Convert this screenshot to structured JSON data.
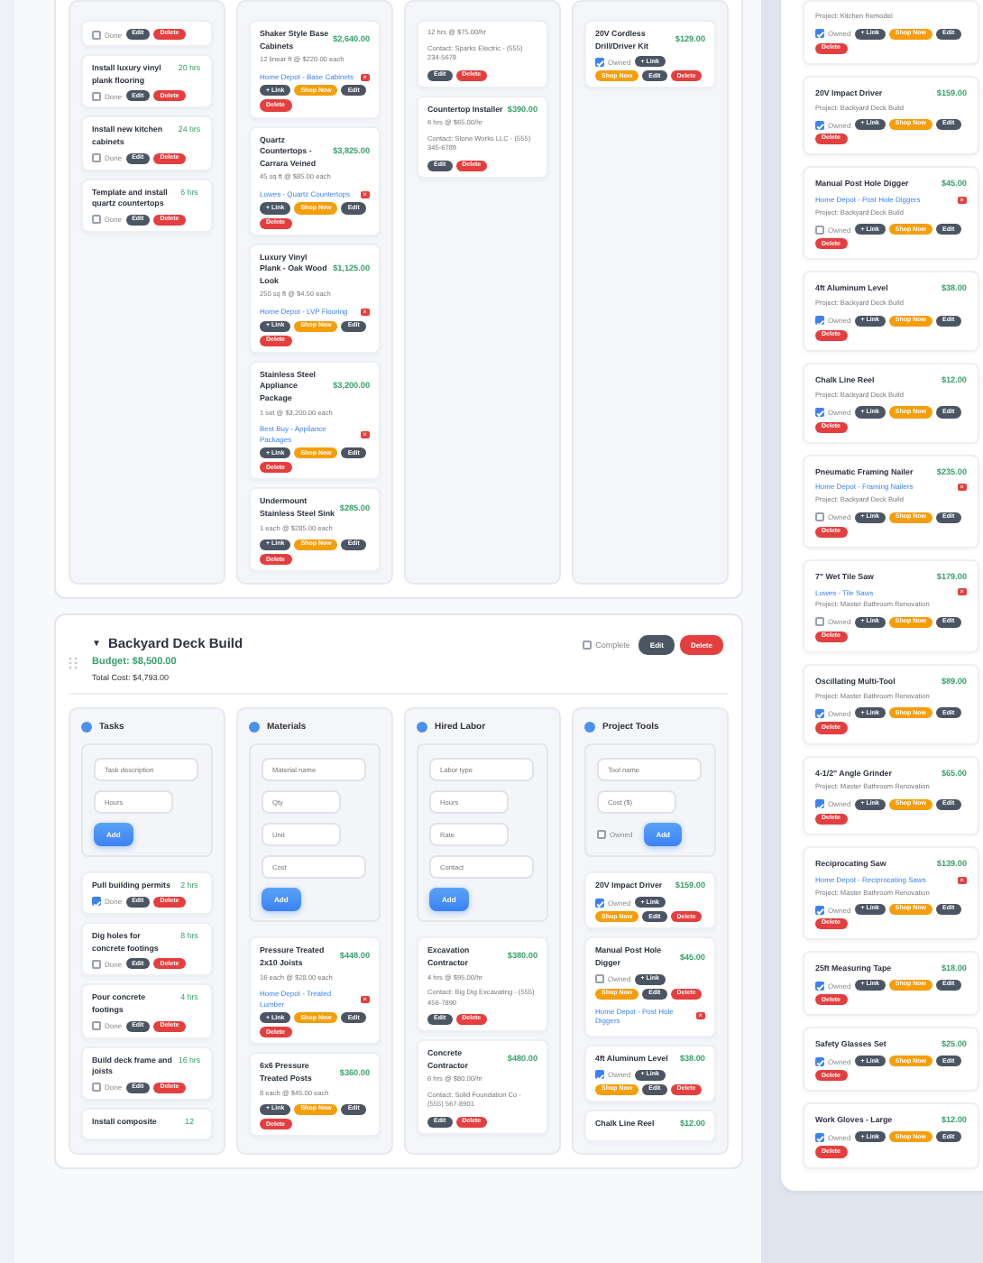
{
  "kitchen_project": {
    "tasks": [
      {
        "done_label": "Done",
        "done": false,
        "edit_button": "Edit",
        "delete_button": "Delete"
      },
      {
        "name": "Install luxury vinyl plank flooring",
        "hours": "20 hrs",
        "done_label": "Done",
        "done": false,
        "edit_button": "Edit",
        "delete_button": "Delete"
      },
      {
        "name": "Install new kitchen cabinets",
        "hours": "24 hrs",
        "done_label": "Done",
        "done": false,
        "edit_button": "Edit",
        "delete_button": "Delete"
      },
      {
        "name": "Template and install quartz countertops",
        "hours": "6 hrs",
        "done_label": "Done",
        "done": false,
        "edit_button": "Edit",
        "delete_button": "Delete"
      }
    ],
    "materials": [
      {
        "name": "Shaker Style Base Cabinets",
        "price": "$2,640.00",
        "detail": "12 linear ft @ $220.00 each",
        "link": "Home Depot - Base Cabinets",
        "link_remove": "×",
        "link_button": "+ Link",
        "shop_button": "Shop Now",
        "edit_button": "Edit",
        "delete_button": "Delete"
      },
      {
        "name": "Quartz Countertops - Carrara Veined",
        "price": "$3,825.00",
        "detail": "45 sq ft @ $85.00 each",
        "link": "Lowes - Quartz Countertops",
        "link_remove": "×",
        "link_button": "+ Link",
        "shop_button": "Shop Now",
        "edit_button": "Edit",
        "delete_button": "Delete"
      },
      {
        "name": "Luxury Vinyl Plank - Oak Wood Look",
        "price": "$1,125.00",
        "detail": "250 sq ft @ $4.50 each",
        "link": "Home Depot - LVP Flooring",
        "link_remove": "×",
        "link_button": "+ Link",
        "shop_button": "Shop Now",
        "edit_button": "Edit",
        "delete_button": "Delete"
      },
      {
        "name": "Stainless Steel Appliance Package",
        "price": "$3,200.00",
        "detail": "1 set @ $3,200.00 each",
        "link": "Best Buy - Appliance Packages",
        "link_remove": "×",
        "link_button": "+ Link",
        "shop_button": "Shop Now",
        "edit_button": "Edit",
        "delete_button": "Delete"
      },
      {
        "name": "Undermount Stainless Steel Sink",
        "price": "$285.00",
        "detail": "1 each @ $285.00 each",
        "link_button": "+ Link",
        "shop_button": "Shop Now",
        "edit_button": "Edit",
        "delete_button": "Delete"
      }
    ],
    "labor": [
      {
        "detail": "12 hrs @ $75.00/hr",
        "contact": "Contact: Sparks Electric - (555) 234-5678",
        "edit_button": "Edit",
        "delete_button": "Delete"
      },
      {
        "name": "Countertop Installer",
        "price": "$390.00",
        "detail": "6 hrs @ $65.00/hr",
        "contact": "Contact: Stone Works LLC - (555) 345-6789",
        "edit_button": "Edit",
        "delete_button": "Delete"
      }
    ],
    "tools": [
      {
        "name": "20V Cordless Drill/Driver Kit",
        "price": "$129.00",
        "owned_label": "Owned",
        "owned": true,
        "link_button": "+ Link",
        "shop_button": "Shop Now",
        "edit_button": "Edit",
        "delete_button": "Delete"
      }
    ]
  },
  "deck_project": {
    "toggle": "▼",
    "title": "Backyard Deck Build",
    "budget": "Budget: $8,500.00",
    "total_cost": "Total Cost: $4,793.00",
    "complete_label": "Complete",
    "complete": false,
    "edit_button": "Edit",
    "delete_button": "Delete",
    "columns": [
      {
        "kind": "tasks",
        "title": "Tasks",
        "form": {
          "placeholders": [
            "Task description",
            "Hours"
          ],
          "add_button": "Add"
        },
        "items": [
          {
            "name": "Pull building permits",
            "hours": "2 hrs",
            "done_label": "Done",
            "done": true,
            "edit_button": "Edit",
            "delete_button": "Delete"
          },
          {
            "name": "Dig holes for concrete footings",
            "hours": "8 hrs",
            "done_label": "Done",
            "done": false,
            "edit_button": "Edit",
            "delete_button": "Delete"
          },
          {
            "name": "Pour concrete footings",
            "hours": "4 hrs",
            "done_label": "Done",
            "done": false,
            "edit_button": "Edit",
            "delete_button": "Delete"
          },
          {
            "name": "Build deck frame and joists",
            "hours": "16 hrs",
            "done_label": "Done",
            "done": false,
            "edit_button": "Edit",
            "delete_button": "Delete"
          },
          {
            "name": "Install composite",
            "hours": "12"
          }
        ]
      },
      {
        "kind": "materials",
        "title": "Materials",
        "form": {
          "placeholders": [
            "Material name",
            "Qty",
            "Unit",
            "Cost"
          ],
          "add_button": "Add"
        },
        "items": [
          {
            "name": "Pressure Treated 2x10 Joists",
            "price": "$448.00",
            "detail": "16 each @ $28.00 each",
            "link": "Home Depot - Treated Lumber",
            "link_remove": "×",
            "link_button": "+ Link",
            "shop_button": "Shop Now",
            "edit_button": "Edit",
            "delete_button": "Delete"
          },
          {
            "name": "6x6 Pressure Treated Posts",
            "price": "$360.00",
            "detail": "8 each @ $45.00 each",
            "link_button": "+ Link",
            "shop_button": "Shop Now",
            "edit_button": "Edit",
            "delete_button": "Delete"
          }
        ]
      },
      {
        "kind": "labor",
        "title": "Hired Labor",
        "form": {
          "placeholders": [
            "Labor type",
            "Hours",
            "Rate",
            "Contact"
          ],
          "add_button": "Add"
        },
        "items": [
          {
            "name": "Excavation Contractor",
            "price": "$380.00",
            "detail": "4 hrs @ $95.00/hr",
            "contact": "Contact: Big Dig Excavating - (555) 456-7890",
            "edit_button": "Edit",
            "delete_button": "Delete"
          },
          {
            "name": "Concrete Contractor",
            "price": "$480.00",
            "detail": "6 hrs @ $80.00/hr",
            "contact": "Contact: Solid Foundation Co - (555) 567-8901",
            "edit_button": "Edit",
            "delete_button": "Delete"
          }
        ]
      },
      {
        "kind": "tools",
        "title": "Project Tools",
        "form": {
          "placeholders": [
            "Tool name",
            "Cost ($)"
          ],
          "owned_label": "Owned",
          "owned": false,
          "add_button": "Add"
        },
        "items": [
          {
            "name": "20V Impact Driver",
            "price": "$159.00",
            "owned_label": "Owned",
            "owned": true,
            "link_button": "+ Link",
            "shop_button": "Shop Now",
            "edit_button": "Edit",
            "delete_button": "Delete"
          },
          {
            "name": "Manual Post Hole Digger",
            "price": "$45.00",
            "owned_label": "Owned",
            "owned": false,
            "link_button": "+ Link",
            "shop_button": "Shop Now",
            "edit_button": "Edit",
            "delete_button": "Delete",
            "link": "Home Depot - Post Hole Diggers",
            "link_remove": "×"
          },
          {
            "name": "4ft Aluminum Level",
            "price": "$38.00",
            "owned_label": "Owned",
            "owned": true,
            "link_button": "+ Link",
            "shop_button": "Shop Now",
            "edit_button": "Edit",
            "delete_button": "Delete"
          },
          {
            "name": "Chalk Line Reel",
            "price": "$12.00"
          }
        ]
      }
    ]
  },
  "all_tools": [
    {
      "project": "Project: Kitchen Remodel",
      "owned_label": "Owned",
      "owned": true,
      "link_button": "+ Link",
      "shop_button": "Shop Now",
      "edit_button": "Edit",
      "delete_button": "Delete"
    },
    {
      "name": "20V Impact Driver",
      "price": "$159.00",
      "project": "Project: Backyard Deck Build",
      "owned_label": "Owned",
      "owned": true,
      "link_button": "+ Link",
      "shop_button": "Shop Now",
      "edit_button": "Edit",
      "delete_button": "Delete"
    },
    {
      "name": "Manual Post Hole Digger",
      "price": "$45.00",
      "link": "Home Depot - Post Hole Diggers",
      "link_remove": "×",
      "project": "Project: Backyard Deck Build",
      "owned_label": "Owned",
      "owned": false,
      "link_button": "+ Link",
      "shop_button": "Shop Now",
      "edit_button": "Edit",
      "delete_button": "Delete"
    },
    {
      "name": "4ft Aluminum Level",
      "price": "$38.00",
      "project": "Project: Backyard Deck Build",
      "owned_label": "Owned",
      "owned": true,
      "link_button": "+ Link",
      "shop_button": "Shop Now",
      "edit_button": "Edit",
      "delete_button": "Delete"
    },
    {
      "name": "Chalk Line Reel",
      "price": "$12.00",
      "project": "Project: Backyard Deck Build",
      "owned_label": "Owned",
      "owned": true,
      "link_button": "+ Link",
      "shop_button": "Shop Now",
      "edit_button": "Edit",
      "delete_button": "Delete"
    },
    {
      "name": "Pneumatic Framing Nailer",
      "price": "$235.00",
      "link": "Home Depot - Framing Nailers",
      "link_remove": "×",
      "project": "Project: Backyard Deck Build",
      "owned_label": "Owned",
      "owned": false,
      "link_button": "+ Link",
      "shop_button": "Shop Now",
      "edit_button": "Edit",
      "delete_button": "Delete"
    },
    {
      "name": "7\" Wet Tile Saw",
      "price": "$179.00",
      "link": "Lowes - Tile Saws",
      "link_remove": "×",
      "project": "Project: Master Bathroom Renovation",
      "owned_label": "Owned",
      "owned": false,
      "link_button": "+ Link",
      "shop_button": "Shop Now",
      "edit_button": "Edit",
      "delete_button": "Delete"
    },
    {
      "name": "Oscillating Multi-Tool",
      "price": "$89.00",
      "project": "Project: Master Bathroom Renovation",
      "owned_label": "Owned",
      "owned": true,
      "link_button": "+ Link",
      "shop_button": "Shop Now",
      "edit_button": "Edit",
      "delete_button": "Delete"
    },
    {
      "name": "4-1/2\" Angle Grinder",
      "price": "$65.00",
      "project": "Project: Master Bathroom Renovation",
      "owned_label": "Owned",
      "owned": true,
      "link_button": "+ Link",
      "shop_button": "Shop Now",
      "edit_button": "Edit",
      "delete_button": "Delete"
    },
    {
      "name": "Reciprocating Saw",
      "price": "$139.00",
      "link": "Home Depot - Reciprocating Saws",
      "link_remove": "×",
      "project": "Project: Master Bathroom Renovation",
      "owned_label": "Owned",
      "owned": true,
      "link_button": "+ Link",
      "shop_button": "Shop Now",
      "edit_button": "Edit",
      "delete_button": "Delete"
    },
    {
      "name": "25ft Measuring Tape",
      "price": "$18.00",
      "owned_label": "Owned",
      "owned": true,
      "link_button": "+ Link",
      "shop_button": "Shop Now",
      "edit_button": "Edit",
      "delete_button": "Delete"
    },
    {
      "name": "Safety Glasses Set",
      "price": "$25.00",
      "owned_label": "Owned",
      "owned": true,
      "link_button": "+ Link",
      "shop_button": "Shop Now",
      "edit_button": "Edit",
      "delete_button": "Delete"
    },
    {
      "name": "Work Gloves - Large",
      "price": "$12.00",
      "owned_label": "Owned",
      "owned": true,
      "link_button": "+ Link",
      "shop_button": "Shop Now",
      "edit_button": "Edit",
      "delete_button": "Delete"
    }
  ]
}
